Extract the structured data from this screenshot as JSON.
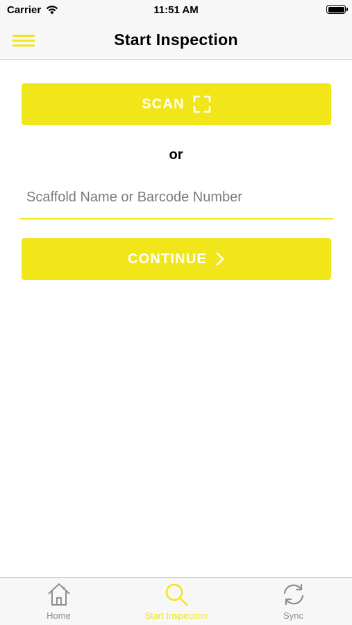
{
  "status_bar": {
    "carrier": "Carrier",
    "time": "11:51 AM"
  },
  "nav": {
    "title": "Start Inspection",
    "menu_icon": "hamburger-menu-icon"
  },
  "scan_button": {
    "label": "SCAN",
    "icon": "scan-frame-icon"
  },
  "or_text": "or",
  "search": {
    "value": "",
    "placeholder": "Scaffold Name or Barcode Number"
  },
  "continue_button": {
    "label": "CONTINUE",
    "icon": "chevron-right-icon"
  },
  "tabs": [
    {
      "label": "Home",
      "icon": "home-icon",
      "active": false
    },
    {
      "label": "Start Inspection",
      "icon": "search-icon",
      "active": true
    },
    {
      "label": "Sync",
      "icon": "sync-icon",
      "active": false
    }
  ],
  "colors": {
    "accent": "#f0e61a",
    "inactive_tab": "#8e8e8e",
    "bar_background": "#f7f7f7"
  }
}
